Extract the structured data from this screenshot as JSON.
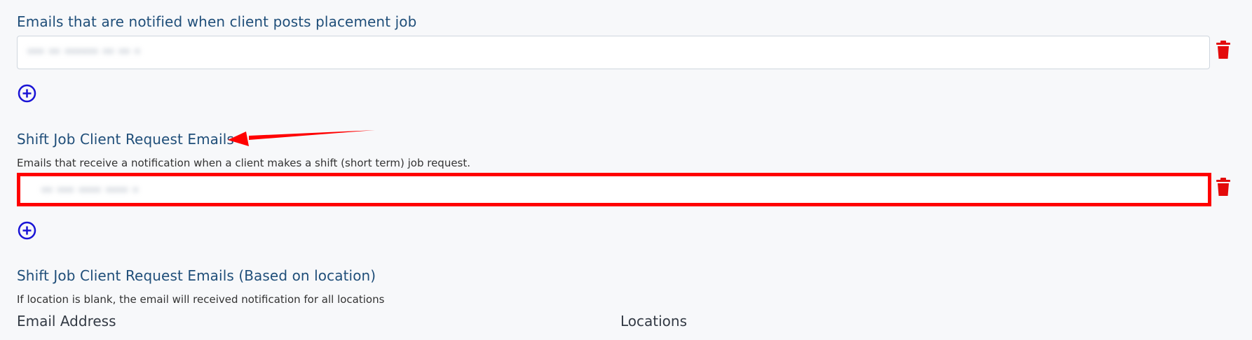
{
  "placement_section": {
    "title": "Emails that are notified when client posts placement job",
    "email_value": "•••  ••  ••••••  ••  ••  •"
  },
  "shift_section": {
    "title": "Shift Job Client Request Emails",
    "description": "Emails that receive a notification when a client makes a shift (short term) job request.",
    "email_value": "••  •••  ••••  ••••  •"
  },
  "location_section": {
    "title": "Shift Job Client Request Emails (Based on location)",
    "description": "If location is blank, the email will received notification for all locations",
    "col_email": "Email Address",
    "col_locations": "Locations"
  },
  "colors": {
    "heading": "#1f4e79",
    "delete": "#e30b0b",
    "add": "#1a14d6",
    "highlight": "#ff0000"
  },
  "icons": {
    "delete": "trash-icon",
    "add": "plus-circle-icon",
    "annotation": "red-arrow"
  }
}
